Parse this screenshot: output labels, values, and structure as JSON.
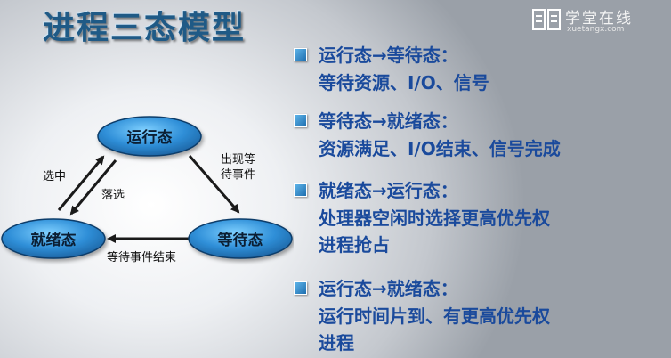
{
  "title": "进程三态模型",
  "brand": {
    "name": "学堂在线",
    "url": "xuetangx.com"
  },
  "diagram": {
    "states": {
      "running": "运行态",
      "ready": "就绪态",
      "waiting": "等待态"
    },
    "labels": {
      "event_wait_1": "出现等",
      "event_wait_2": "待事件",
      "select": "选中",
      "preempt": "落选",
      "event_done": "等待事件结束"
    }
  },
  "bullets": [
    {
      "head": "运行态→等待态：",
      "lines": [
        "等待资源、I/O、信号"
      ]
    },
    {
      "head": "等待态→就绪态：",
      "lines": [
        "资源满足、I/O结束、信号完成"
      ]
    },
    {
      "head": "就绪态→运行态：",
      "lines": [
        "处理器空闲时选择更高优先权",
        "进程抢占"
      ]
    },
    {
      "head": "运行态→就绪态：",
      "lines": [
        "运行时间片到、有更高优先权",
        "进程"
      ]
    }
  ]
}
